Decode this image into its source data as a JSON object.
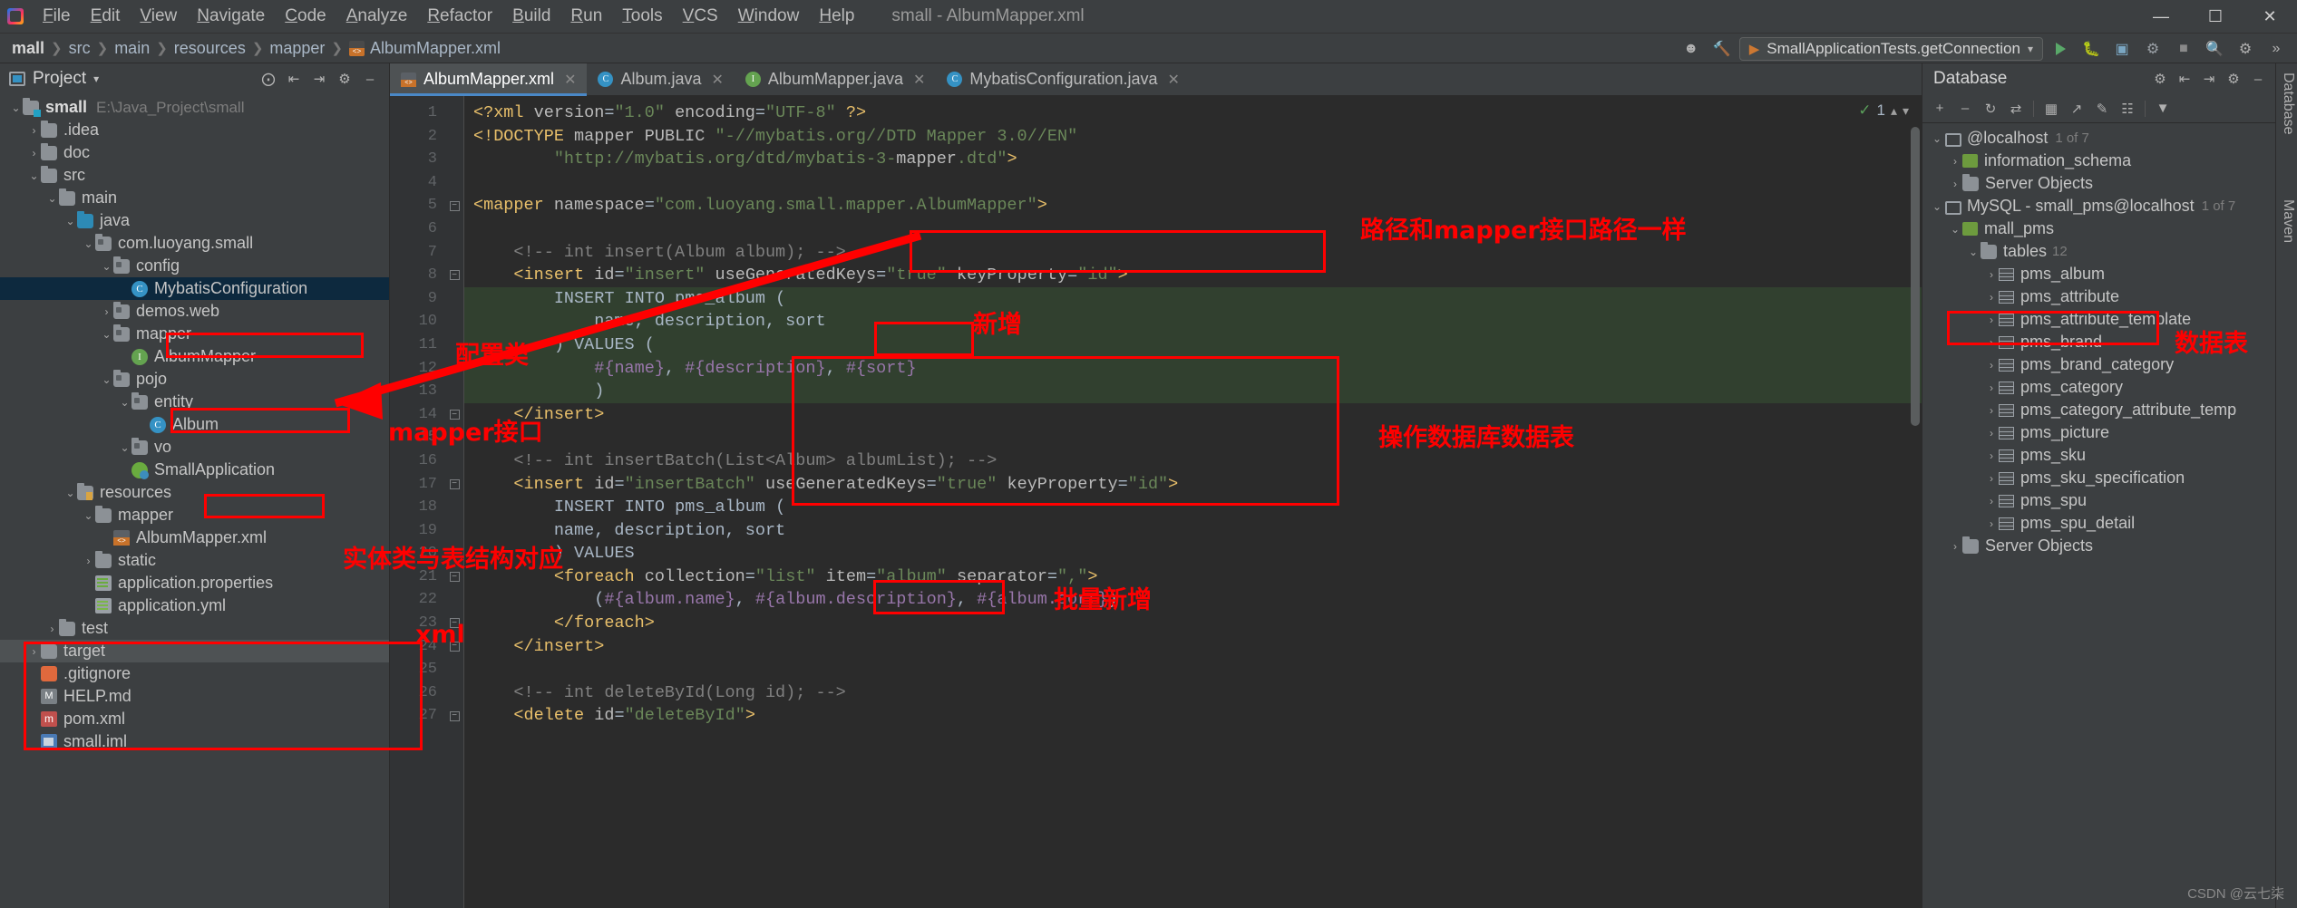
{
  "window": {
    "title": "small - AlbumMapper.xml",
    "menus": [
      "File",
      "Edit",
      "View",
      "Navigate",
      "Code",
      "Analyze",
      "Refactor",
      "Build",
      "Run",
      "Tools",
      "VCS",
      "Window",
      "Help"
    ],
    "minimize": "—",
    "maximize": "☐",
    "close": "✕"
  },
  "toolbar": {
    "breadcrumbs": [
      "mall",
      "src",
      "main",
      "resources",
      "mapper",
      "AlbumMapper.xml"
    ],
    "run_config": "SmallApplicationTests.getConnection",
    "run_icon": "run-icon",
    "debug_icon": "debug-icon",
    "coverage_icon": "coverage-icon",
    "profile_icon": "profile-icon",
    "stop_icon": "stop-icon",
    "search_icon": "search-icon",
    "settings_icon": "gear-icon",
    "avatar_icon": "user-icon",
    "build_icon": "hammer-icon"
  },
  "project_panel": {
    "title": "Project",
    "tree": [
      {
        "depth": 0,
        "arrow": "⌄",
        "icon": "folder-module",
        "label": "small",
        "path": "E:\\Java_Project\\small",
        "bold": true
      },
      {
        "depth": 1,
        "arrow": "›",
        "icon": "folder",
        "label": ".idea"
      },
      {
        "depth": 1,
        "arrow": "›",
        "icon": "folder",
        "label": "doc"
      },
      {
        "depth": 1,
        "arrow": "⌄",
        "icon": "folder",
        "label": "src"
      },
      {
        "depth": 2,
        "arrow": "⌄",
        "icon": "folder",
        "label": "main"
      },
      {
        "depth": 3,
        "arrow": "⌄",
        "icon": "folder-src",
        "label": "java"
      },
      {
        "depth": 4,
        "arrow": "⌄",
        "icon": "package",
        "label": "com.luoyang.small"
      },
      {
        "depth": 5,
        "arrow": "⌄",
        "icon": "package",
        "label": "config"
      },
      {
        "depth": 6,
        "arrow": "",
        "icon": "class",
        "label": "MybatisConfiguration",
        "selected": true
      },
      {
        "depth": 5,
        "arrow": "›",
        "icon": "package",
        "label": "demos.web"
      },
      {
        "depth": 5,
        "arrow": "⌄",
        "icon": "package",
        "label": "mapper"
      },
      {
        "depth": 6,
        "arrow": "",
        "icon": "interface",
        "label": "AlbumMapper"
      },
      {
        "depth": 5,
        "arrow": "⌄",
        "icon": "package",
        "label": "pojo"
      },
      {
        "depth": 6,
        "arrow": "⌄",
        "icon": "package",
        "label": "entity"
      },
      {
        "depth": 7,
        "arrow": "",
        "icon": "class",
        "label": "Album"
      },
      {
        "depth": 6,
        "arrow": "⌄",
        "icon": "package",
        "label": "vo"
      },
      {
        "depth": 6,
        "arrow": "",
        "icon": "spring",
        "label": "SmallApplication"
      },
      {
        "depth": 3,
        "arrow": "⌄",
        "icon": "folder-resources",
        "label": "resources"
      },
      {
        "depth": 4,
        "arrow": "⌄",
        "icon": "folder",
        "label": "mapper"
      },
      {
        "depth": 5,
        "arrow": "",
        "icon": "xml",
        "label": "AlbumMapper.xml"
      },
      {
        "depth": 4,
        "arrow": "›",
        "icon": "folder",
        "label": "static"
      },
      {
        "depth": 4,
        "arrow": "",
        "icon": "properties",
        "label": "application.properties"
      },
      {
        "depth": 4,
        "arrow": "",
        "icon": "yml",
        "label": "application.yml"
      },
      {
        "depth": 2,
        "arrow": "›",
        "icon": "folder",
        "label": "test"
      },
      {
        "depth": 1,
        "arrow": "›",
        "icon": "folder",
        "label": "target",
        "highlight": true
      },
      {
        "depth": 1,
        "arrow": "",
        "icon": "gitignore",
        "label": ".gitignore"
      },
      {
        "depth": 1,
        "arrow": "",
        "icon": "markdown",
        "label": "HELP.md"
      },
      {
        "depth": 1,
        "arrow": "",
        "icon": "maven",
        "label": "pom.xml"
      },
      {
        "depth": 1,
        "arrow": "",
        "icon": "iml",
        "label": "small.iml"
      }
    ]
  },
  "editor": {
    "tabs": [
      {
        "label": "AlbumMapper.xml",
        "icon": "xml",
        "active": true
      },
      {
        "label": "Album.java",
        "icon": "class",
        "active": false
      },
      {
        "label": "AlbumMapper.java",
        "icon": "interface",
        "active": false
      },
      {
        "label": "MybatisConfiguration.java",
        "icon": "class",
        "active": false
      }
    ],
    "inspection_count": "1",
    "lines": [
      {
        "n": 1,
        "text": "<?xml version=\"1.0\" encoding=\"UTF-8\" ?>"
      },
      {
        "n": 2,
        "text": "<!DOCTYPE mapper PUBLIC \"-//mybatis.org//DTD Mapper 3.0//EN\""
      },
      {
        "n": 3,
        "text": "        \"http://mybatis.org/dtd/mybatis-3-mapper.dtd\">"
      },
      {
        "n": 4,
        "text": ""
      },
      {
        "n": 5,
        "text": "<mapper namespace=\"com.luoyang.small.mapper.AlbumMapper\">"
      },
      {
        "n": 6,
        "text": ""
      },
      {
        "n": 7,
        "text": "    <!-- int insert(Album album); -->"
      },
      {
        "n": 8,
        "text": "    <insert id=\"insert\" useGeneratedKeys=\"true\" keyProperty=\"id\">"
      },
      {
        "n": 9,
        "text": "        INSERT INTO pms_album ("
      },
      {
        "n": 10,
        "text": "            name, description, sort"
      },
      {
        "n": 11,
        "text": "        ) VALUES ("
      },
      {
        "n": 12,
        "text": "            #{name}, #{description}, #{sort}"
      },
      {
        "n": 13,
        "text": "            )"
      },
      {
        "n": 14,
        "text": "    </insert>"
      },
      {
        "n": 15,
        "text": ""
      },
      {
        "n": 16,
        "text": "    <!-- int insertBatch(List<Album> albumList); -->"
      },
      {
        "n": 17,
        "text": "    <insert id=\"insertBatch\" useGeneratedKeys=\"true\" keyProperty=\"id\">"
      },
      {
        "n": 18,
        "text": "        INSERT INTO pms_album ("
      },
      {
        "n": 19,
        "text": "        name, description, sort"
      },
      {
        "n": 20,
        "text": "        ) VALUES"
      },
      {
        "n": 21,
        "text": "        <foreach collection=\"list\" item=\"album\" separator=\",\">"
      },
      {
        "n": 22,
        "text": "            (#{album.name}, #{album.description}, #{album.sort})"
      },
      {
        "n": 23,
        "text": "        </foreach>"
      },
      {
        "n": 24,
        "text": "    </insert>"
      },
      {
        "n": 25,
        "text": ""
      },
      {
        "n": 26,
        "text": "    <!-- int deleteById(Long id); -->"
      },
      {
        "n": 27,
        "text": "    <delete id=\"deleteById\">"
      }
    ]
  },
  "database_panel": {
    "title": "Database",
    "tree": [
      {
        "depth": 0,
        "arrow": "⌄",
        "icon": "connection",
        "label": "@localhost",
        "badge": "1 of 7"
      },
      {
        "depth": 1,
        "arrow": "›",
        "icon": "schema",
        "label": "information_schema"
      },
      {
        "depth": 1,
        "arrow": "›",
        "icon": "folder",
        "label": "Server Objects"
      },
      {
        "depth": 0,
        "arrow": "⌄",
        "icon": "connection",
        "label": "MySQL - small_pms@localhost",
        "badge": "1 of 7"
      },
      {
        "depth": 1,
        "arrow": "⌄",
        "icon": "schema",
        "label": "mall_pms"
      },
      {
        "depth": 2,
        "arrow": "⌄",
        "icon": "folder",
        "label": "tables",
        "count": "12"
      },
      {
        "depth": 3,
        "arrow": "›",
        "icon": "table",
        "label": "pms_album"
      },
      {
        "depth": 3,
        "arrow": "›",
        "icon": "table",
        "label": "pms_attribute"
      },
      {
        "depth": 3,
        "arrow": "›",
        "icon": "table",
        "label": "pms_attribute_template"
      },
      {
        "depth": 3,
        "arrow": "›",
        "icon": "table",
        "label": "pms_brand"
      },
      {
        "depth": 3,
        "arrow": "›",
        "icon": "table",
        "label": "pms_brand_category"
      },
      {
        "depth": 3,
        "arrow": "›",
        "icon": "table",
        "label": "pms_category"
      },
      {
        "depth": 3,
        "arrow": "›",
        "icon": "table",
        "label": "pms_category_attribute_temp"
      },
      {
        "depth": 3,
        "arrow": "›",
        "icon": "table",
        "label": "pms_picture"
      },
      {
        "depth": 3,
        "arrow": "›",
        "icon": "table",
        "label": "pms_sku"
      },
      {
        "depth": 3,
        "arrow": "›",
        "icon": "table",
        "label": "pms_sku_specification"
      },
      {
        "depth": 3,
        "arrow": "›",
        "icon": "table",
        "label": "pms_spu"
      },
      {
        "depth": 3,
        "arrow": "›",
        "icon": "table",
        "label": "pms_spu_detail"
      },
      {
        "depth": 1,
        "arrow": "›",
        "icon": "folder",
        "label": "Server Objects"
      }
    ],
    "toolbar_icons": [
      "add-icon",
      "minus-icon",
      "refresh-icon",
      "sync-icon",
      "table-icon",
      "jump-icon",
      "edit-icon",
      "console-icon",
      "filter-icon"
    ]
  },
  "right_strip": {
    "labels": [
      "Database",
      "Maven"
    ]
  },
  "annotations": {
    "config_class": "配置类",
    "mapper_interface": "mapper接口",
    "entity_table": "实体类与表结构对应",
    "xml": "xml",
    "namespace_path": "路径和mapper接口路径一样",
    "insert_new": "新增",
    "batch_insert": "批量新增",
    "operate_table": "操作数据库数据表",
    "data_table": "数据表"
  },
  "watermark": "CSDN @云七柒"
}
